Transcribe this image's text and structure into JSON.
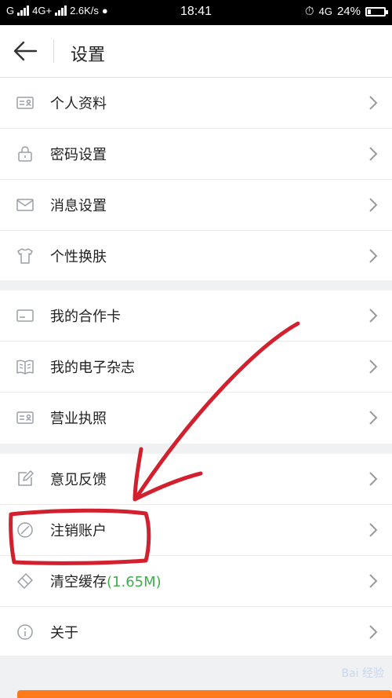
{
  "status_bar": {
    "carrier_left": "G",
    "network": "4G+",
    "speed": "2.6K/s",
    "time": "18:41",
    "network_right": "4G",
    "battery": "24%"
  },
  "header": {
    "title": "设置"
  },
  "groups": [
    {
      "items": [
        {
          "label": "个人资料",
          "icon": "id-card-icon"
        },
        {
          "label": "密码设置",
          "icon": "lock-icon"
        },
        {
          "label": "消息设置",
          "icon": "envelope-icon"
        },
        {
          "label": "个性换肤",
          "icon": "shirt-icon"
        }
      ]
    },
    {
      "items": [
        {
          "label": "我的合作卡",
          "icon": "card-icon"
        },
        {
          "label": "我的电子杂志",
          "icon": "book-icon"
        },
        {
          "label": "营业执照",
          "icon": "license-icon"
        }
      ]
    },
    {
      "items": [
        {
          "label": "意见反馈",
          "icon": "edit-icon"
        },
        {
          "label": "注销账户",
          "icon": "cancel-icon"
        },
        {
          "label": "清空缓存",
          "extra": "(1.65M)",
          "icon": "eraser-icon"
        },
        {
          "label": "关于",
          "icon": "info-icon"
        }
      ]
    }
  ],
  "watermark": "Bai 经验",
  "colors": {
    "accent": "#ff7a1a",
    "annotation": "#d2202e",
    "cache_size": "#3fae4a"
  }
}
